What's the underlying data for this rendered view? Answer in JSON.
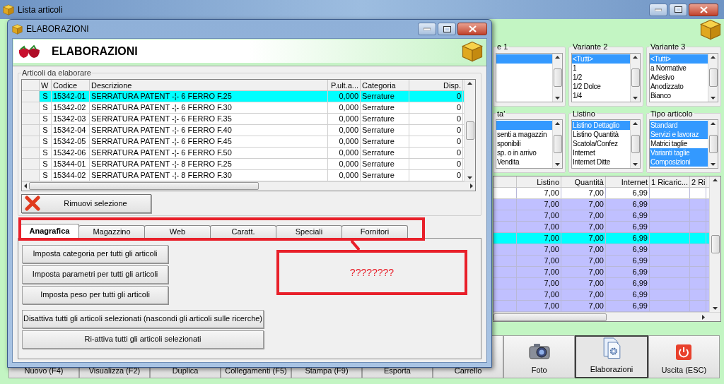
{
  "main_window": {
    "title": "Lista articoli",
    "filter_groups": [
      {
        "title": "e 1",
        "items": [
          {
            "selected": true
          }
        ]
      },
      {
        "title": "Variante 2",
        "items": [
          {
            "text": "<Tutti>",
            "selected": true
          },
          {
            "text": "1",
            "selected": false
          },
          {
            "text": "1/2",
            "selected": false
          },
          {
            "text": "1/2 Dolce",
            "selected": false
          },
          {
            "text": "1/4",
            "selected": false
          }
        ]
      },
      {
        "title": "Variante 3",
        "items": [
          {
            "text": "<Tutti>",
            "selected": true
          },
          {
            "text": "a Normative",
            "selected": false
          },
          {
            "text": "Adesivo",
            "selected": false
          },
          {
            "text": "Anodizzato",
            "selected": false
          },
          {
            "text": "Bianco",
            "selected": false
          }
        ]
      },
      {
        "title": "ta'",
        "items": [
          {
            "selected": true
          },
          {
            "text": "senti a magazzin",
            "selected": false
          },
          {
            "text": "sponibili",
            "selected": false
          },
          {
            "text": "sp. o in arrivo",
            "selected": false
          },
          {
            "text": "Vendita",
            "selected": false
          }
        ]
      },
      {
        "title": "Listino",
        "items": [
          {
            "text": "Listino Dettaglio",
            "selected": true
          },
          {
            "text": "Listino Quantità",
            "selected": false
          },
          {
            "text": "Scatola/Confez",
            "selected": false
          },
          {
            "text": "Internet",
            "selected": false
          },
          {
            "text": "Internet Ditte",
            "selected": false
          }
        ]
      },
      {
        "title": "Tipo articolo",
        "items": [
          {
            "text": "Standard",
            "selected": true
          },
          {
            "text": "Servizi e lavoraz",
            "selected": true
          },
          {
            "text": "Matrici taglie",
            "selected": false
          },
          {
            "text": "Varianti taglie",
            "selected": true
          },
          {
            "text": "Composizioni",
            "selected": true
          }
        ]
      }
    ],
    "price_table": {
      "columns": [
        "Listino",
        "Quantità",
        "Internet",
        "1 Ricaric...",
        "2 Ri"
      ],
      "rows": [
        {
          "cells": [
            "7,00",
            "7,00",
            "6,99"
          ],
          "marked": false,
          "selected": false
        },
        {
          "cells": [
            "7,00",
            "7,00",
            "6,99"
          ],
          "marked": true,
          "selected": false
        },
        {
          "cells": [
            "7,00",
            "7,00",
            "6,99"
          ],
          "marked": true,
          "selected": false
        },
        {
          "cells": [
            "7,00",
            "7,00",
            "6,99"
          ],
          "marked": true,
          "selected": false
        },
        {
          "cells": [
            "7,00",
            "7,00",
            "6,99"
          ],
          "marked": true,
          "selected": true
        },
        {
          "cells": [
            "7,00",
            "7,00",
            "6,99"
          ],
          "marked": true,
          "selected": false
        },
        {
          "cells": [
            "7,00",
            "7,00",
            "6,99"
          ],
          "marked": true,
          "selected": false
        },
        {
          "cells": [
            "7,00",
            "7,00",
            "6,99"
          ],
          "marked": true,
          "selected": false
        },
        {
          "cells": [
            "7,00",
            "7,00",
            "6,99"
          ],
          "marked": true,
          "selected": false
        },
        {
          "cells": [
            "7,00",
            "7,00",
            "6,99"
          ],
          "marked": true,
          "selected": false
        },
        {
          "cells": [
            "7,00",
            "7,00",
            "6,99"
          ],
          "marked": true,
          "selected": false
        }
      ]
    },
    "command_buttons": [
      "Nuovo (F4)",
      "Visualizza (F2)",
      "Duplica",
      "Collegamenti (F5)",
      "Stampa (F9)",
      "Esporta",
      "Carrello"
    ],
    "tool_buttons": [
      {
        "label": "Foto",
        "pressed": false
      },
      {
        "label": "Elaborazioni",
        "pressed": true
      },
      {
        "label": "Uscita (ESC)",
        "pressed": false
      }
    ]
  },
  "dialog": {
    "title": "ELABORAZIONI",
    "header_title": "ELABORAZIONI",
    "group_title": "Articoli da elaborare",
    "table": {
      "columns": [
        "W",
        "Codice",
        "Descrizione",
        "P.ult.a...",
        "Categoria",
        "Disp."
      ],
      "rows": [
        {
          "cells": [
            "S",
            "15342-01",
            "SERRATURA PATENT -¦- 6 FERRO F.25",
            "0,000",
            "Serrature",
            "0"
          ],
          "selected": true
        },
        {
          "cells": [
            "S",
            "15342-02",
            "SERRATURA PATENT -¦- 6 FERRO F.30",
            "0,000",
            "Serrature",
            "0"
          ],
          "selected": false
        },
        {
          "cells": [
            "S",
            "15342-03",
            "SERRATURA PATENT -¦- 6 FERRO F.35",
            "0,000",
            "Serrature",
            "0"
          ],
          "selected": false
        },
        {
          "cells": [
            "S",
            "15342-04",
            "SERRATURA PATENT -¦- 6 FERRO F.40",
            "0,000",
            "Serrature",
            "0"
          ],
          "selected": false
        },
        {
          "cells": [
            "S",
            "15342-05",
            "SERRATURA PATENT -¦- 6 FERRO F.45",
            "0,000",
            "Serrature",
            "0"
          ],
          "selected": false
        },
        {
          "cells": [
            "S",
            "15342-06",
            "SERRATURA PATENT -¦- 6 FERRO F.50",
            "0,000",
            "Serrature",
            "0"
          ],
          "selected": false
        },
        {
          "cells": [
            "S",
            "15344-01",
            "SERRATURA PATENT -¦- 8 FERRO F.25",
            "0,000",
            "Serrature",
            "0"
          ],
          "selected": false
        },
        {
          "cells": [
            "S",
            "15344-02",
            "SERRATURA PATENT -¦- 8 FERRO F.30",
            "0,000",
            "Serrature",
            "0"
          ],
          "selected": false
        }
      ]
    },
    "remove_button": "Rimuovi selezione",
    "tabs": [
      {
        "label": "Anagrafica",
        "selected": true
      },
      {
        "label": "Magazzino",
        "selected": false
      },
      {
        "label": "Web",
        "selected": false
      },
      {
        "label": "Caratt.",
        "selected": false
      },
      {
        "label": "Speciali",
        "selected": false
      },
      {
        "label": "Fornitori",
        "selected": false
      }
    ],
    "actions": [
      {
        "label": "Imposta categoria per tutti gli articoli",
        "kind": "short"
      },
      {
        "label": "Imposta parametri per tutti gli articoli",
        "kind": "short"
      },
      {
        "label": "Imposta peso per tutti gli articoli",
        "kind": "short"
      },
      {
        "label": "Disattiva tutti gli articoli selezionati (nascondi gli articoli sulle ricerche)",
        "kind": "long"
      },
      {
        "label": "Ri-attiva tutti gli articoli selezionati",
        "kind": "long"
      }
    ],
    "annotation": {
      "text": "????????"
    }
  }
}
